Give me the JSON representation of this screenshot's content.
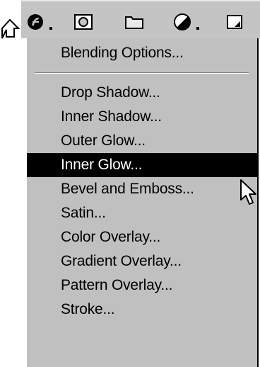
{
  "toolbar": {
    "buttons": [
      {
        "icon": "layer-style-icon",
        "has_dropdown": true
      },
      {
        "icon": "add-layer-mask-icon",
        "has_dropdown": false
      },
      {
        "icon": "layer-set-folder-icon",
        "has_dropdown": false
      },
      {
        "icon": "adjustment-layer-icon",
        "has_dropdown": true
      },
      {
        "icon": "new-layer-icon",
        "has_dropdown": false
      }
    ]
  },
  "menu": {
    "header_item": "Blending Options...",
    "items": [
      "Drop Shadow...",
      "Inner Shadow...",
      "Outer Glow...",
      "Inner Glow...",
      "Bevel and Emboss...",
      "Satin...",
      "Color Overlay...",
      "Gradient Overlay...",
      "Pattern Overlay...",
      "Stroke..."
    ],
    "highlighted_item": "Inner Glow..."
  },
  "colors": {
    "menu_background": "#c0c0c0",
    "highlight_background": "#000000",
    "highlight_text": "#ffffff"
  }
}
